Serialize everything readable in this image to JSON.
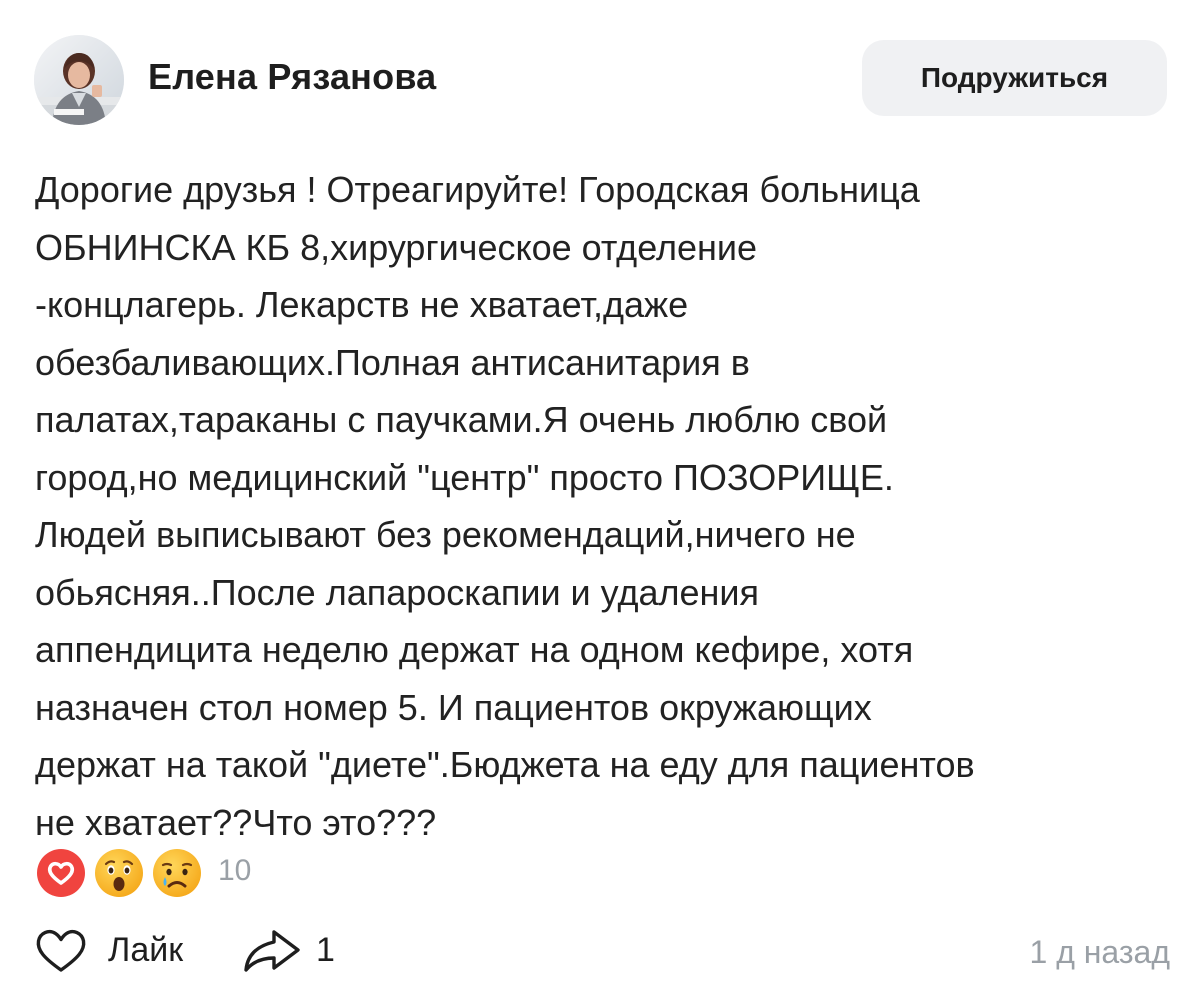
{
  "post": {
    "author": {
      "name": "Елена Рязанова"
    },
    "add_friend_label": "Подружиться",
    "text": "Дорогие друзья ! Отреагируйте! Городская больница\nОБНИНСКА КБ 8,хирургическое отделение\n-концлагерь. Лекарств не хватает,даже\nобезбаливающих.Полная антисанитария  в\nпалатах,тараканы с паучками.Я очень люблю свой\nгород,но медицинский \"центр\" просто ПОЗОРИЩЕ.\nЛюдей выписывают без рекомендаций,ничего не\nобьясняя..После лапароскапии и удаления\nаппендицита неделю держат на одном кефире, хотя\nназначен стол номер 5. И пациентов окружающих\nдержат на такой \"диете\".Бюджета на еду для пациентов\nне хватает??Что это???",
    "reactions": {
      "icons": [
        "heart-icon",
        "wow-emoji-icon",
        "sad-tear-emoji-icon"
      ],
      "count": "10"
    },
    "actions": {
      "like_label": "Лайк",
      "share_count": "1"
    },
    "timestamp": "1 д назад"
  },
  "colors": {
    "heart_red": "#f0443f",
    "emoji_yellow": "#f7b21b",
    "muted_gray": "#9aa0a6",
    "button_bg": "#f0f1f3"
  }
}
